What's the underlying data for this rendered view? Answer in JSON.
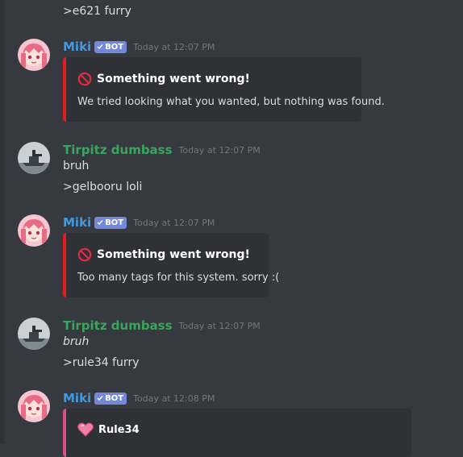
{
  "colors": {
    "bot_user": "#3f9ae6",
    "human_user": "#3ba55d",
    "error_bar": "#e31d1d",
    "rule34_bar": "#d94e8c"
  },
  "messages": {
    "m0": {
      "text": ">e621 furry"
    },
    "m1": {
      "username": "Miki",
      "bot_tag": "BOT",
      "timestamp": "Today at 12:07 PM",
      "embed_title": "Something went wrong!",
      "embed_desc": "We tried looking what you wanted, but nothing was found.",
      "title_icon": "prohibited-icon"
    },
    "m2": {
      "username": "Tirpitz dumbass",
      "timestamp": "Today at 12:07 PM",
      "line1": "bruh",
      "line2": ">gelbooru loli"
    },
    "m3": {
      "username": "Miki",
      "bot_tag": "BOT",
      "timestamp": "Today at 12:07 PM",
      "embed_title": "Something went wrong!",
      "embed_desc": "Too many tags for this system. sorry :(",
      "title_icon": "prohibited-icon"
    },
    "m4": {
      "username": "Tirpitz dumbass",
      "timestamp": "Today at 12:07 PM",
      "line1": "bruh",
      "line2": ">rule34 furry"
    },
    "m5": {
      "username": "Miki",
      "bot_tag": "BOT",
      "timestamp": "Today at 12:08 PM",
      "embed_title": "Rule34",
      "title_icon": "pink-heart-icon"
    }
  }
}
